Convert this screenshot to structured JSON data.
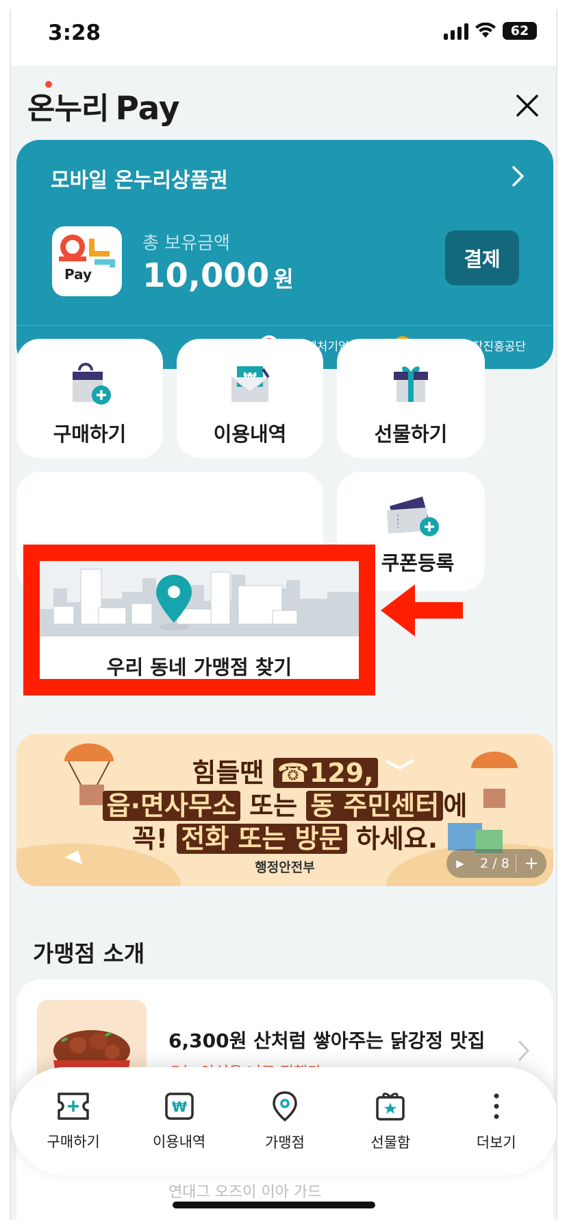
{
  "status": {
    "time": "3:28",
    "battery": "62"
  },
  "header": {
    "logo_text": "온누리",
    "logo_pay": "Pay"
  },
  "card": {
    "title": "모바일 온누리상품권",
    "logo_text": "Pay",
    "balance_label": "총 보유금액",
    "balance_amount": "10,000",
    "balance_unit": "원",
    "pay_button": "결제",
    "sponsor_1": "중소벤처기업부",
    "sponsor_sep": "×",
    "sponsor_2": "소상공인시장진흥공단"
  },
  "tiles": {
    "buy": "구매하기",
    "history": "이용내역",
    "gift": "선물하기",
    "find_store": "우리 동네 가맹점 찾기",
    "coupon": "쿠폰등록"
  },
  "banner": {
    "line1_a": "힘들땐",
    "line1_b": "☎129,",
    "line2_a": "읍·면사무소",
    "line2_b": "또는",
    "line2_c": "동 주민센터",
    "line2_d": "에",
    "line3_a": "꼭!",
    "line3_b": "전화 또는 방문",
    "line3_c": "하세요.",
    "ministry": "행정안전부",
    "pager": "2 / 8"
  },
  "section": {
    "title": "가맹점 소개"
  },
  "store": {
    "title": "6,300원 산처럼 쌓아주는 닭강정 맛집",
    "subtitle": "오늘 야식은 너로 정했다",
    "peek": "연대그 오즈이 이아 가드"
  },
  "nav": {
    "items": [
      {
        "label": "구매하기",
        "icon": "ticket-plus-icon"
      },
      {
        "label": "이용내역",
        "icon": "won-icon"
      },
      {
        "label": "가맹점",
        "icon": "location-pin-icon"
      },
      {
        "label": "선물함",
        "icon": "gift-star-icon"
      },
      {
        "label": "더보기",
        "icon": "more-vertical-icon"
      }
    ]
  },
  "colors": {
    "card": "#1e97b0",
    "pay_button": "#14687c",
    "highlight_box": "#ff1f00",
    "teal": "#16a4ad"
  }
}
